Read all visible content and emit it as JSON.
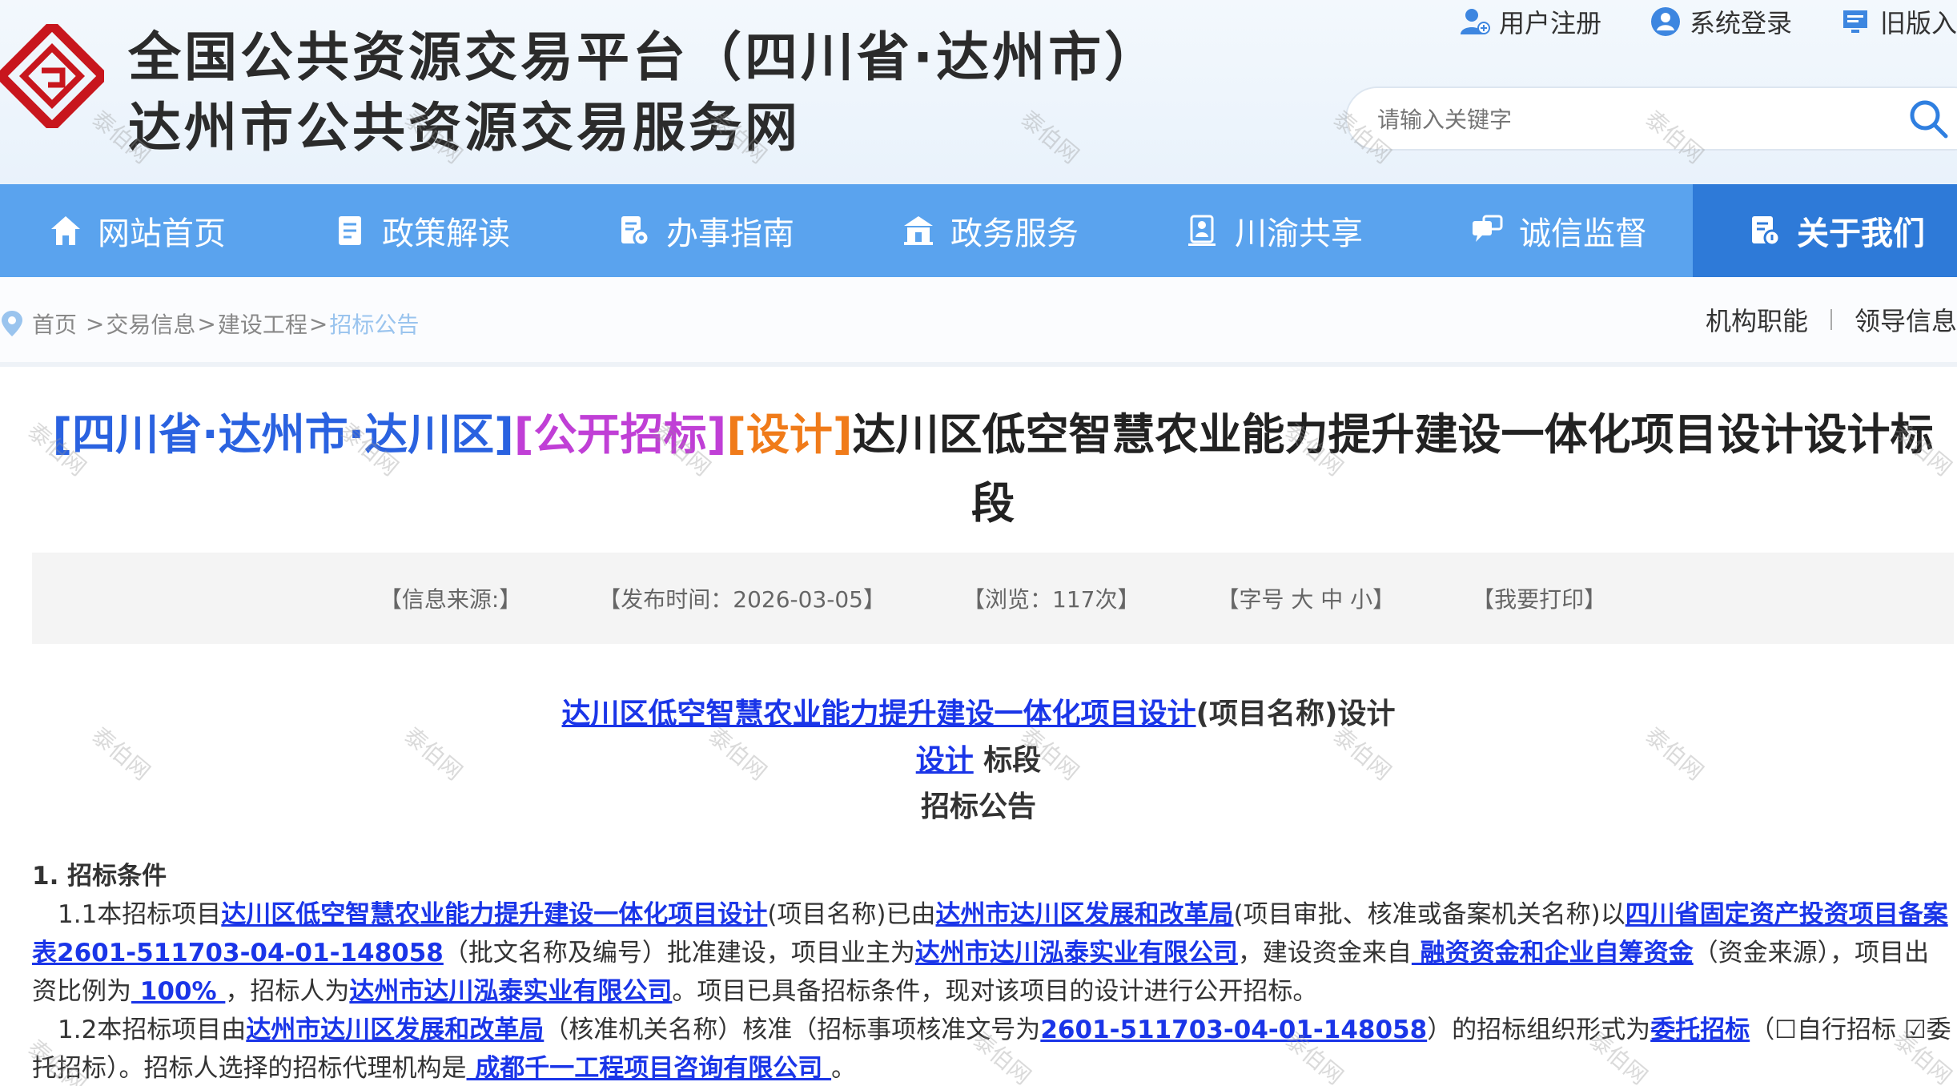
{
  "header": {
    "title_line1": "全国公共资源交易平台（四川省·达州市）",
    "title_line2": "达州市公共资源交易服务网",
    "top_links": [
      "用户注册",
      "系统登录",
      "旧版入"
    ],
    "search_placeholder": "请输入关键字"
  },
  "nav": {
    "items": [
      "网站首页",
      "政策解读",
      "办事指南",
      "政务服务",
      "川渝共享",
      "诚信监督"
    ],
    "active": "关于我们"
  },
  "breadcrumb": {
    "items": [
      "首页",
      "交易信息",
      "建设工程"
    ],
    "current": "招标公告",
    "right_links": [
      "机构职能",
      "领导信息"
    ]
  },
  "article": {
    "tag1": "[四川省·达州市·达川区]",
    "tag2": "[公开招标]",
    "tag3": "[设计]",
    "title_rest": "达川区低空智慧农业能力提升建设一体化项目设计设计标段",
    "meta": [
      "【信息来源:】",
      "【发布时间：2026-03-05】",
      "【浏览：117次】",
      "【字号 大 中 小】",
      "【我要打印】"
    ],
    "sub_project": "达川区低空智慧农业能力提升建设一体化项目设计",
    "sub_project_suffix": "(项目名称)设计",
    "sub_section": "设计",
    "sub_section_suffix": " 标段",
    "sub_notice": "招标公告",
    "section1_heading": "1. 招标条件",
    "p1": {
      "a": "1.1本招标项目",
      "b": "达川区低空智慧农业能力提升建设一体化项目设计",
      "c": "(项目名称)已由",
      "d": "达州市达川区发展和改革局",
      "e": "(项目审批、核准或备案机关名称)以",
      "f": "四川省固定资产投资项目备案表2601-511703-04-01-148058",
      "g": "（批文名称及编号）批准建设，项目业主为",
      "h": "达州市达川泓泰实业有限公司",
      "i": "，建设资金来自",
      "j": " 融资资金和企业自筹资金",
      "k": "（资金来源），项目出资比例为",
      "l": " 100% ",
      "m": "，招标人为",
      "n": "达州市达川泓泰实业有限公司",
      "o": "。项目已具备招标条件，现对该项目的设计进行公开招标。"
    },
    "p2": {
      "a": "1.2本招标项目由",
      "b": "达州市达川区发展和改革局",
      "c": "（核准机关名称）核准（招标事项核准文号为",
      "d": "2601-511703-04-01-148058",
      "e": "）的招标组织形式为",
      "f": "委托招标",
      "g": "（☐自行招标 ☑委托招标）。招标人选择的招标代理机构是",
      "h": " 成都千一工程项目咨询有限公司 ",
      "i": "。"
    }
  },
  "watermark": "泰伯网"
}
